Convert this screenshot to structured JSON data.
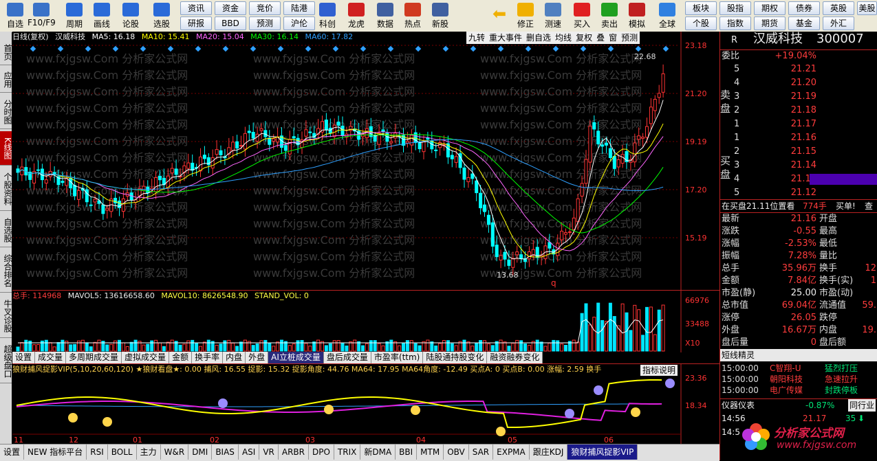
{
  "toolbar": {
    "buttons": [
      "自选",
      "F10/F9",
      "周期",
      "画线",
      "论股",
      "选股",
      "科创",
      "龙虎",
      "数据",
      "热点",
      "新股",
      "修正",
      "测速",
      "买入",
      "卖出",
      "模拟",
      "全球"
    ],
    "small": [
      "资讯",
      "资金",
      "竞价",
      "陆港",
      "研报",
      "BBD",
      "预测",
      "沪伦",
      "板块",
      "股指",
      "期权",
      "债券",
      "英股",
      "个股",
      "指数",
      "期货",
      "基金",
      "外汇",
      "美股"
    ]
  },
  "lefttabs": [
    "首页",
    "应用",
    "分时图",
    "K线图",
    "个股资料",
    "自选股",
    "综合排名",
    "牛叉诊股",
    "超级盘口"
  ],
  "kline": {
    "legend": {
      "period": "日线(复权)",
      "name": "汉威科技",
      "ma5": "MA5: 16.18",
      "ma10": "MA10: 15.41",
      "ma20": "MA20: 15.04",
      "ma30": "MA30: 16.14",
      "ma60": "MA60: 17.82"
    },
    "tools": [
      "九转",
      "重大事件",
      "删自选",
      "均线",
      "复权",
      "叠",
      "窗",
      "预测"
    ],
    "axis": [
      "23.18",
      "21.20",
      "19.19",
      "17.20",
      "15.19"
    ],
    "high_label": "22.68",
    "low_label": "13.68",
    "q_label": "q",
    "watermark": "www.fxjgsw.Com 分析家公式网"
  },
  "volume": {
    "legend": {
      "total": "总手: 114968",
      "mavol5": "MAVOL5: 13616658.60",
      "mavol10": "MAVOL10: 8626548.90",
      "stand": "STAND_VOL: 0"
    },
    "axis": [
      "66976",
      "33488",
      "X10"
    ],
    "tabs": [
      "设置",
      "成交量",
      "多周期成交量",
      "虚拟成交量",
      "金额",
      "换手率",
      "内盘",
      "外盘",
      "AI立桩成交量",
      "盘后成交量",
      "市盈率(ttm)",
      "陆股通持股变化",
      "融资融券变化"
    ],
    "active_tab": "AI立桩成交量"
  },
  "indicator": {
    "legend": "狼财捕风捉影VIP(5,10,20,60,120) ★狼财看盘★: 0.00 捕风: 16.55 捉影: 15.32 捉影角度: 44.76 MA64: 17.95 MA64角度: -12.49 买点A: 0 买点B: 0.00 涨幅: 2.59 换手",
    "explain": "指标说明",
    "axis": [
      "23.36",
      "18.34"
    ],
    "months": [
      "11",
      "12",
      "01",
      "02",
      "03",
      "04",
      "05",
      "06"
    ]
  },
  "bottombar": [
    "设置",
    "NEW 指标平台",
    "RSI",
    "BOLL",
    "主力",
    "W&R",
    "DMI",
    "BIAS",
    "ASI",
    "VR",
    "ARBR",
    "DPO",
    "TRIX",
    "新DMA",
    "BBI",
    "MTM",
    "OBV",
    "SAR",
    "EXPMA",
    "跟庄KDJ",
    "狼财捕风捉影VIP"
  ],
  "quote": {
    "code_label": "R",
    "name": "汉威科技",
    "code": "300007",
    "webi_label": "委比",
    "webi": "+19.04%",
    "sell_label": "卖盘",
    "buy_label": "买盘",
    "asks": [
      [
        "5",
        "21.21"
      ],
      [
        "4",
        "21.20"
      ],
      [
        "3",
        "21.19"
      ],
      [
        "2",
        "21.18"
      ],
      [
        "1",
        "21.17"
      ]
    ],
    "bids": [
      [
        "1",
        "21.16"
      ],
      [
        "2",
        "21.15"
      ],
      [
        "3",
        "21.14"
      ],
      [
        "4",
        "21.13"
      ],
      [
        "5",
        "21.12"
      ]
    ],
    "buying_line": "在买盘21.11位置看",
    "buying_qty": "774手",
    "buying_tag": "买单!",
    "buying_more": "查",
    "stats_left": [
      [
        "最新",
        "21.16"
      ],
      [
        "涨跌",
        "-0.55"
      ],
      [
        "涨幅",
        "-2.53%"
      ],
      [
        "振幅",
        "7.28%"
      ],
      [
        "总手",
        "35.96万"
      ],
      [
        "金额",
        "7.84亿"
      ],
      [
        "市盈(静)",
        "25.00"
      ],
      [
        "总市值",
        "69.04亿"
      ],
      [
        "涨停",
        "26.05"
      ],
      [
        "外盘",
        "16.67万"
      ],
      [
        "盘后量",
        "0"
      ]
    ],
    "stats_right": [
      "开盘",
      "最高",
      "最低",
      "量比",
      "换手",
      "换手(实)",
      "市盈(动)",
      "流通值",
      "跌停",
      "内盘",
      "盘后额"
    ],
    "stats_right_vals": [
      "",
      "",
      "",
      "",
      "12",
      "1",
      "",
      "59.",
      "",
      "19.",
      ""
    ],
    "short_title": "短线精灵",
    "short": [
      [
        "15:00:00",
        "C智翔-U",
        "猛烈打压"
      ],
      [
        "15:00:00",
        "朝阳科技",
        "急速拉升"
      ],
      [
        "15:00:00",
        "电广传媒",
        "封跌停板"
      ]
    ],
    "meter_label": "仪器仪表",
    "meter_val": "-0.87%",
    "meter_more": "同行业",
    "tick_time": "14:56",
    "tick_price": "21.17",
    "tick_vol": "35",
    "tick_time2": "14:5",
    "logo": "分析家公式网",
    "logo_url": "www.fxjgsw.com"
  },
  "colors": {
    "ma5": "#ffffff",
    "ma10": "#ffff00",
    "ma20": "#ff66ff",
    "ma30": "#00ff00",
    "ma60": "#2fa0ff",
    "up": "#ff3333",
    "down": "#00ffff"
  }
}
